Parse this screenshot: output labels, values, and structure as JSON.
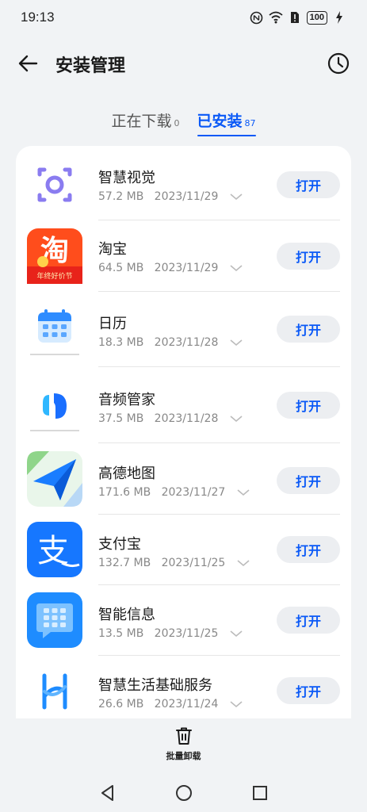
{
  "status_bar": {
    "time": "19:13",
    "battery": "100"
  },
  "app_bar": {
    "title": "安装管理"
  },
  "tabs": [
    {
      "label": "正在下载",
      "count": "0",
      "active": false
    },
    {
      "label": "已安装",
      "count": "87",
      "active": true
    }
  ],
  "apps": [
    {
      "name": "智慧视觉",
      "size": "57.2 MB",
      "date": "2023/11/29",
      "action": "打开",
      "icon": "smart-vision-icon"
    },
    {
      "name": "淘宝",
      "size": "64.5 MB",
      "date": "2023/11/29",
      "action": "打开",
      "icon": "taobao-icon",
      "icon_text": "淘",
      "icon_banner": "年终好价节"
    },
    {
      "name": "日历",
      "size": "18.3 MB",
      "date": "2023/11/28",
      "action": "打开",
      "icon": "calendar-icon"
    },
    {
      "name": "音频管家",
      "size": "37.5 MB",
      "date": "2023/11/28",
      "action": "打开",
      "icon": "audio-manager-icon"
    },
    {
      "name": "高德地图",
      "size": "171.6 MB",
      "date": "2023/11/27",
      "action": "打开",
      "icon": "amap-icon"
    },
    {
      "name": "支付宝",
      "size": "132.7 MB",
      "date": "2023/11/25",
      "action": "打开",
      "icon": "alipay-icon",
      "icon_text": "支"
    },
    {
      "name": "智能信息",
      "size": "13.5 MB",
      "date": "2023/11/25",
      "action": "打开",
      "icon": "smart-message-icon"
    },
    {
      "name": "智慧生活基础服务",
      "size": "26.6 MB",
      "date": "2023/11/24",
      "action": "打开",
      "icon": "smart-life-icon"
    }
  ],
  "bottom_bar": {
    "label": "批量卸载"
  },
  "colors": {
    "accent": "#0a59f7",
    "background": "#f1f3f5",
    "card": "#ffffff",
    "button_bg": "#eceef1"
  }
}
